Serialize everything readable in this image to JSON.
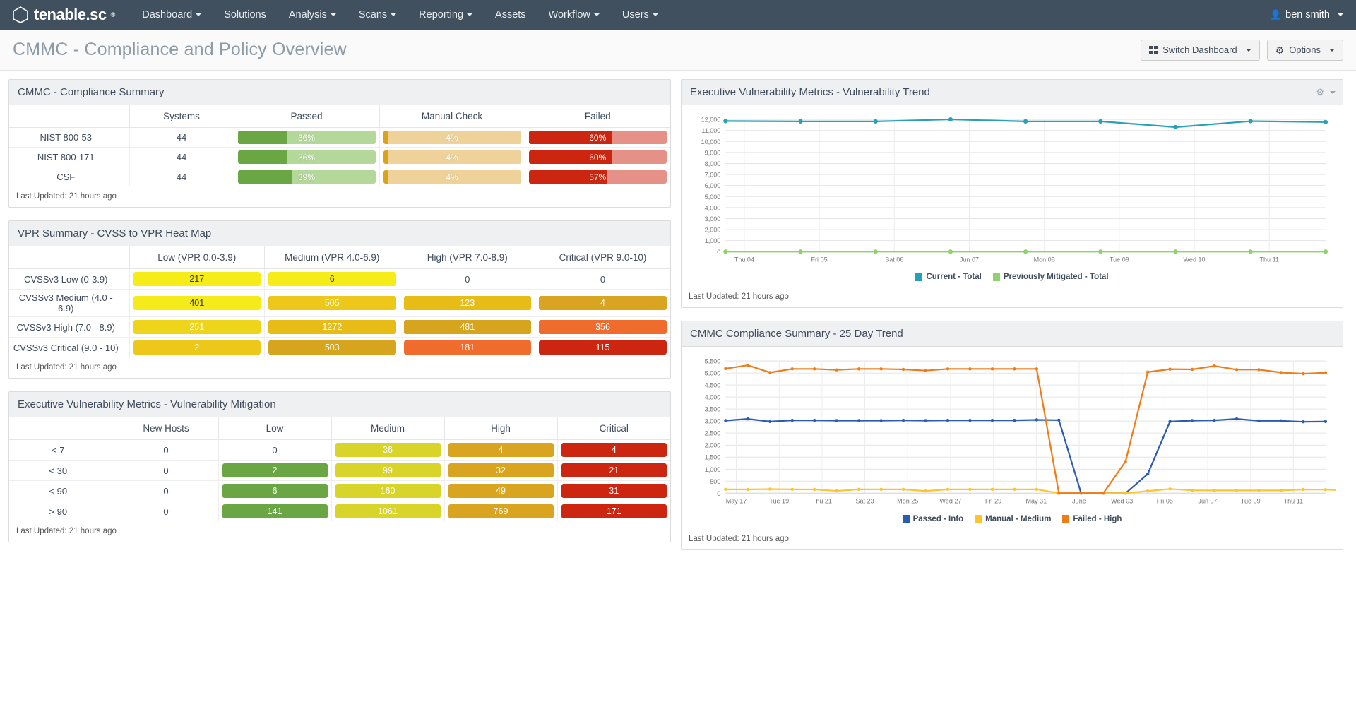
{
  "navbar": {
    "brand": "tenable.sc",
    "brand_tm": "®",
    "items": [
      {
        "label": "Dashboard",
        "caret": true
      },
      {
        "label": "Solutions",
        "caret": false
      },
      {
        "label": "Analysis",
        "caret": true
      },
      {
        "label": "Scans",
        "caret": true
      },
      {
        "label": "Reporting",
        "caret": true
      },
      {
        "label": "Assets",
        "caret": false
      },
      {
        "label": "Workflow",
        "caret": true
      },
      {
        "label": "Users",
        "caret": true
      }
    ],
    "user": "ben smith"
  },
  "header": {
    "title": "CMMC - Compliance and Policy Overview",
    "switch_dashboard": "Switch Dashboard",
    "options": "Options"
  },
  "panels": {
    "compliance_summary": {
      "title": "CMMC - Compliance Summary",
      "last_updated": "Last Updated: 21 hours ago",
      "columns": [
        "",
        "Systems",
        "Passed",
        "Manual Check",
        "Failed"
      ],
      "rows": [
        {
          "label": "NIST 800-53",
          "systems": "44",
          "passed": "36%",
          "passed_pct": 36,
          "manual": "4%",
          "manual_pct": 4,
          "failed": "60%",
          "failed_pct": 60
        },
        {
          "label": "NIST 800-171",
          "systems": "44",
          "passed": "36%",
          "passed_pct": 36,
          "manual": "4%",
          "manual_pct": 4,
          "failed": "60%",
          "failed_pct": 60
        },
        {
          "label": "CSF",
          "systems": "44",
          "passed": "39%",
          "passed_pct": 39,
          "manual": "4%",
          "manual_pct": 4,
          "failed": "57%",
          "failed_pct": 57
        }
      ],
      "colors": {
        "passed_fill": "#6aa744",
        "passed_track": "#b4d79a",
        "manual_fill": "#d9a419",
        "manual_track": "#eed29a",
        "failed_fill": "#cc2610",
        "failed_track": "#e59187"
      }
    },
    "vpr_summary": {
      "title": "VPR Summary - CVSS to VPR Heat Map",
      "last_updated": "Last Updated: 21 hours ago",
      "columns": [
        "",
        "Low (VPR 0.0-3.9)",
        "Medium (VPR 4.0-6.9)",
        "High (VPR 7.0-8.9)",
        "Critical (VPR 9.0-10)"
      ],
      "rows": [
        {
          "label": "CVSSv3 Low (0-3.9)",
          "cells": [
            {
              "value": "217",
              "color": "#f6ec17",
              "text": "#333333"
            },
            {
              "value": "6",
              "color": "#f6ec17",
              "text": "#333333"
            },
            {
              "value": "0",
              "color": "",
              "text": "#3f4b5b"
            },
            {
              "value": "0",
              "color": "",
              "text": "#3f4b5b"
            }
          ]
        },
        {
          "label": "CVSSv3 Medium (4.0 - 6.9)",
          "cells": [
            {
              "value": "401",
              "color": "#f5ea1a",
              "text": "#333333"
            },
            {
              "value": "505",
              "color": "#edc81b",
              "text": "#ffffff"
            },
            {
              "value": "123",
              "color": "#e8bc16",
              "text": "#ffffff"
            },
            {
              "value": "4",
              "color": "#d9a41f",
              "text": "#ffffff"
            }
          ]
        },
        {
          "label": "CVSSv3 High (7.0 - 8.9)",
          "cells": [
            {
              "value": "251",
              "color": "#efd41c",
              "text": "#ffffff"
            },
            {
              "value": "1272",
              "color": "#e8bc16",
              "text": "#ffffff"
            },
            {
              "value": "481",
              "color": "#d6a41d",
              "text": "#ffffff"
            },
            {
              "value": "356",
              "color": "#ef6c2d",
              "text": "#ffffff"
            }
          ]
        },
        {
          "label": "CVSSv3 Critical (9.0 - 10)",
          "cells": [
            {
              "value": "2",
              "color": "#edc81b",
              "text": "#ffffff"
            },
            {
              "value": "503",
              "color": "#d6a41d",
              "text": "#ffffff"
            },
            {
              "value": "181",
              "color": "#ef6c2d",
              "text": "#ffffff"
            },
            {
              "value": "115",
              "color": "#cc2610",
              "text": "#ffffff"
            }
          ]
        }
      ]
    },
    "vuln_mitigation": {
      "title": "Executive Vulnerability Metrics - Vulnerability Mitigation",
      "last_updated": "Last Updated: 21 hours ago",
      "columns": [
        "",
        "New Hosts",
        "Low",
        "Medium",
        "High",
        "Critical"
      ],
      "rows": [
        {
          "label": "< 7",
          "new_hosts": "0",
          "cells": [
            {
              "value": "0",
              "color": "",
              "text": "#3f4b5b"
            },
            {
              "value": "36",
              "color": "#d8d42a",
              "text": "#ffffff"
            },
            {
              "value": "4",
              "color": "#d9a41f",
              "text": "#ffffff"
            },
            {
              "value": "4",
              "color": "#cc2610",
              "text": "#ffffff"
            }
          ]
        },
        {
          "label": "< 30",
          "new_hosts": "0",
          "cells": [
            {
              "value": "2",
              "color": "#6aa744",
              "text": "#ffffff"
            },
            {
              "value": "99",
              "color": "#d8d42a",
              "text": "#ffffff"
            },
            {
              "value": "32",
              "color": "#d9a41f",
              "text": "#ffffff"
            },
            {
              "value": "21",
              "color": "#cc2610",
              "text": "#ffffff"
            }
          ]
        },
        {
          "label": "< 90",
          "new_hosts": "0",
          "cells": [
            {
              "value": "6",
              "color": "#6aa744",
              "text": "#ffffff"
            },
            {
              "value": "160",
              "color": "#d8d42a",
              "text": "#ffffff"
            },
            {
              "value": "49",
              "color": "#d9a41f",
              "text": "#ffffff"
            },
            {
              "value": "31",
              "color": "#cc2610",
              "text": "#ffffff"
            }
          ]
        },
        {
          "label": "> 90",
          "new_hosts": "0",
          "cells": [
            {
              "value": "141",
              "color": "#6aa744",
              "text": "#ffffff"
            },
            {
              "value": "1061",
              "color": "#d8d42a",
              "text": "#ffffff"
            },
            {
              "value": "769",
              "color": "#d9a41f",
              "text": "#ffffff"
            },
            {
              "value": "171",
              "color": "#cc2610",
              "text": "#ffffff"
            }
          ]
        }
      ]
    },
    "vuln_trend": {
      "title": "Executive Vulnerability Metrics - Vulnerability Trend",
      "last_updated": "Last Updated: 21 hours ago"
    },
    "cmmc_trend": {
      "title": "CMMC Compliance Summary - 25 Day Trend",
      "last_updated": "Last Updated: 21 hours ago"
    }
  },
  "chart_data": [
    {
      "type": "line",
      "id": "vulnerability-trend",
      "title": "Executive Vulnerability Metrics - Vulnerability Trend",
      "xlabel": "",
      "ylabel": "",
      "ylim": [
        0,
        12000
      ],
      "yticks": [
        0,
        1000,
        2000,
        3000,
        4000,
        5000,
        6000,
        7000,
        8000,
        9000,
        10000,
        11000,
        12000
      ],
      "ytick_labels": [
        "0",
        "1,000",
        "2,000",
        "3,000",
        "4,000",
        "5,000",
        "6,000",
        "7,000",
        "8,000",
        "9,000",
        "10,000",
        "11,000",
        "12,000"
      ],
      "grid": true,
      "legend_position": "bottom",
      "x": [
        "Thu 04",
        "",
        "Fri 05",
        "",
        "Sat 06",
        "",
        "Jun 07",
        "",
        "Mon 08",
        "",
        "Tue 09",
        "",
        "Wed 10",
        "",
        "Thu 11",
        ""
      ],
      "xtick_labels": [
        "Thu 04",
        "Fri 05",
        "Sat 06",
        "Jun 07",
        "Mon 08",
        "Tue 09",
        "Wed 10",
        "Thu 11"
      ],
      "series": [
        {
          "name": "Current - Total",
          "color": "#28a0b5",
          "values": [
            11850,
            11820,
            11820,
            12000,
            11820,
            11820,
            11300,
            11840,
            11760
          ]
        },
        {
          "name": "Previously Mitigated - Total",
          "color": "#8fd16a",
          "values": [
            0,
            0,
            0,
            0,
            0,
            0,
            0,
            0,
            0
          ]
        }
      ]
    },
    {
      "type": "line",
      "id": "cmmc-25-day-trend",
      "title": "CMMC Compliance Summary - 25 Day Trend",
      "xlabel": "",
      "ylabel": "",
      "ylim": [
        0,
        5500
      ],
      "yticks": [
        0,
        500,
        1000,
        1500,
        2000,
        2500,
        3000,
        3500,
        4000,
        4500,
        5000,
        5500
      ],
      "ytick_labels": [
        "0",
        "500",
        "1,000",
        "1,500",
        "2,000",
        "2,500",
        "3,000",
        "3,500",
        "4,000",
        "4,500",
        "5,000",
        "5,500"
      ],
      "grid": true,
      "legend_position": "bottom",
      "xtick_labels": [
        "May 17",
        "Tue 19",
        "Thu 21",
        "Sat 23",
        "Mon 25",
        "Wed 27",
        "Fri 29",
        "May 31",
        "June",
        "Wed 03",
        "Fri 05",
        "Jun 07",
        "Tue 09",
        "Thu 11"
      ],
      "series": [
        {
          "name": "Passed - Info",
          "color": "#2a5db0",
          "values": [
            3020,
            3090,
            2980,
            3030,
            3030,
            3020,
            3020,
            3020,
            3030,
            3020,
            3030,
            3030,
            3030,
            3030,
            3050,
            3040,
            0,
            0,
            0,
            800,
            2980,
            3020,
            3030,
            3090,
            3010,
            3010,
            2970,
            2980
          ]
        },
        {
          "name": "Manual - Medium",
          "color": "#fdc42e",
          "values": [
            160,
            155,
            170,
            160,
            155,
            95,
            160,
            160,
            160,
            90,
            160,
            160,
            160,
            160,
            160,
            0,
            0,
            0,
            0,
            90,
            175,
            120,
            115,
            115,
            115,
            115,
            155,
            150,
            110
          ]
        },
        {
          "name": "Failed - High",
          "color": "#f07c18",
          "values": [
            5180,
            5320,
            5020,
            5170,
            5170,
            5130,
            5170,
            5170,
            5150,
            5100,
            5170,
            5170,
            5170,
            5170,
            5170,
            0,
            0,
            0,
            1320,
            5040,
            5160,
            5150,
            5290,
            5140,
            5140,
            5020,
            4970,
            5010
          ]
        }
      ]
    }
  ]
}
